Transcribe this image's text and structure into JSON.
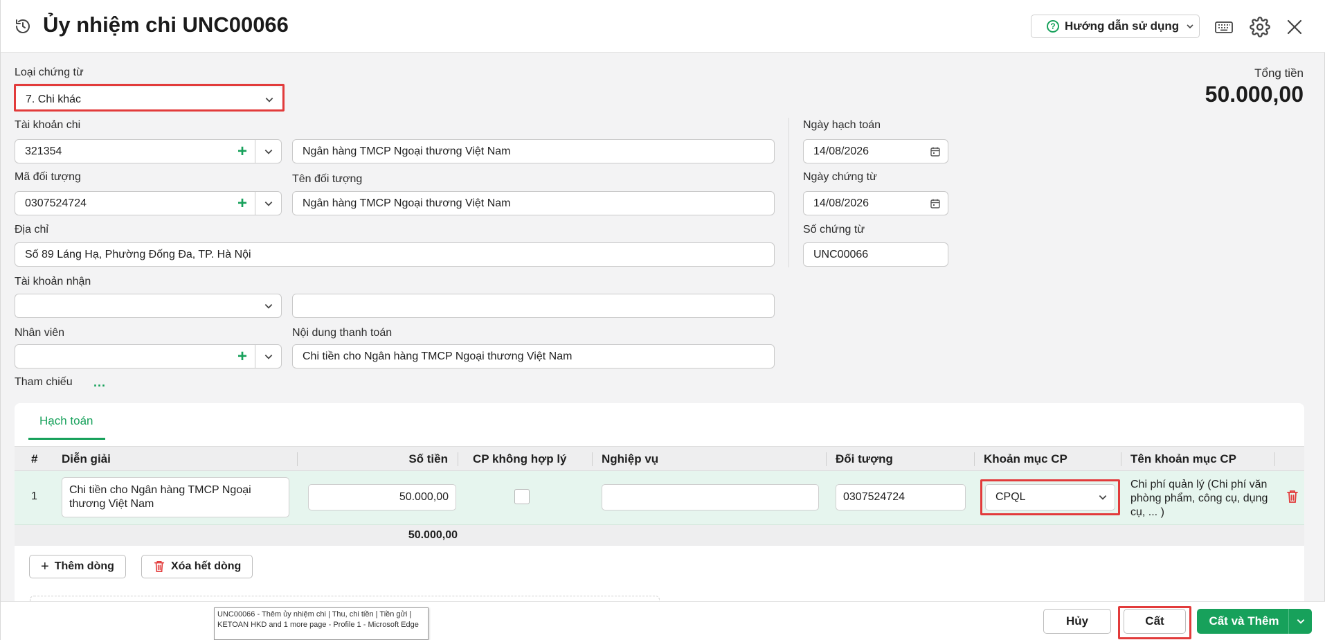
{
  "header": {
    "title": "Ủy nhiệm chi UNC00066",
    "help_label": "Hướng dẫn sử dụng"
  },
  "form": {
    "voucher_type_label": "Loại chứng từ",
    "voucher_type_value": "7. Chi khác",
    "total_label": "Tổng tiền",
    "total_value": "50.000,00",
    "pay_account_label": "Tài khoản chi",
    "pay_account_value": "321354",
    "pay_bank_value": "Ngân hàng TMCP Ngoại thương Việt Nam",
    "object_code_label": "Mã đối tượng",
    "object_code_value": "0307524724",
    "object_name_label": "Tên đối tượng",
    "object_name_value": "Ngân hàng TMCP Ngoại thương Việt Nam",
    "address_label": "Địa chỉ",
    "address_value": "Số 89 Láng Hạ, Phường Đống Đa, TP. Hà Nội",
    "receive_account_label": "Tài khoản nhận",
    "receive_account_value": "",
    "receive_bank_value": "",
    "employee_label": "Nhân viên",
    "employee_value": "",
    "content_label": "Nội dung thanh toán",
    "content_value": "Chi tiền cho Ngân hàng TMCP Ngoại thương Việt Nam",
    "reference_label": "Tham chiếu",
    "reference_more": "...",
    "posting_date_label": "Ngày hạch toán",
    "posting_date_value": "14/08/2026",
    "voucher_date_label": "Ngày chứng từ",
    "voucher_date_value": "14/08/2026",
    "voucher_no_label": "Số chứng từ",
    "voucher_no_value": "UNC00066"
  },
  "grid": {
    "tab_label": "Hạch toán",
    "columns": [
      "#",
      "Diễn giải",
      "Số tiền",
      "CP không hợp lý",
      "Nghiệp vụ",
      "Đối tượng",
      "Khoản mục CP",
      "Tên khoản mục CP"
    ],
    "rows": [
      {
        "num": "1",
        "description": "Chi tiền cho Ngân hàng TMCP Ngoại thương Việt Nam",
        "amount": "50.000,00",
        "unreasonable": false,
        "operation": "",
        "object": "0307524724",
        "expense_item": "CPQL",
        "expense_item_name": "Chi phí quản lý (Chi phí văn phòng phẩm, công cụ, dụng cụ, ... )"
      }
    ],
    "sum_amount": "50.000,00",
    "add_row_label": "Thêm dòng",
    "clear_rows_label": "Xóa hết dòng"
  },
  "footer": {
    "cancel_label": "Hủy",
    "save_label": "Cất",
    "save_add_label": "Cất và Thêm"
  },
  "tooltip": {
    "text": "UNC00066 - Thêm ủy nhiệm chi | Thu, chi tiền | Tiền gửi | KETOAN HKD and 1 more page - Profile 1 - Microsoft Edge"
  },
  "colors": {
    "accent": "#17a15b",
    "highlight": "#e23b3b",
    "row_bg": "#e6f5ee"
  }
}
